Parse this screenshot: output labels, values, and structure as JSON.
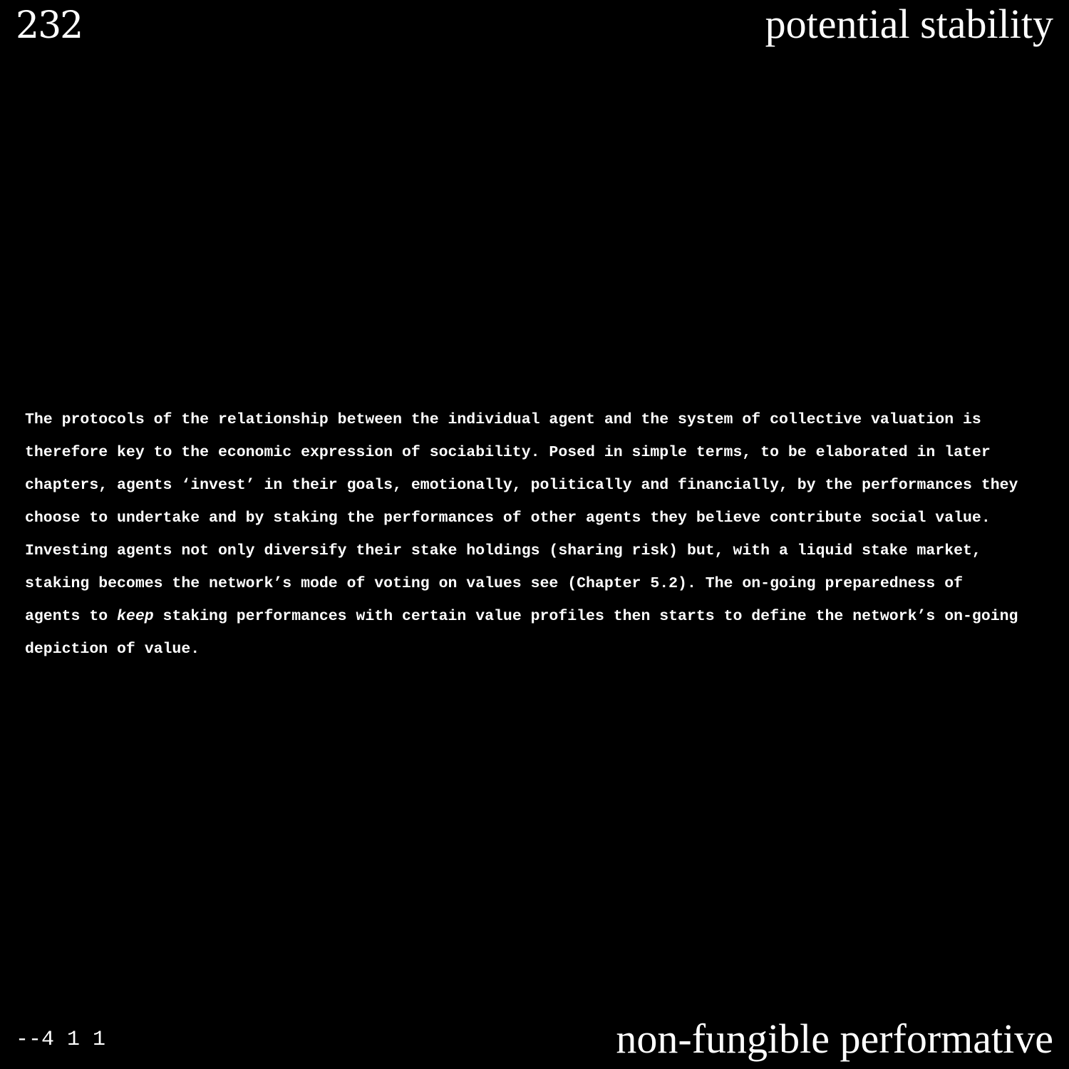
{
  "header": {
    "page_number": "232",
    "running_head": "potential stability"
  },
  "body": {
    "lines": [
      "The protocols of the relationship between the individual agent and the system of collective valuation is",
      "therefore key to the economic expression of sociability. Posed in simple terms, to be elaborated in later",
      "chapters, agents ‘invest’ in their goals, emotionally, politically and financially, by the performances they",
      "choose to undertake and by staking the performances of other agents they believe contribute social value.",
      "Investing agents not only diversify their stake holdings (sharing risk) but, with a liquid stake market,",
      "staking becomes the network’s mode of voting on values see (Chapter 5.2). The on-going preparedness of"
    ],
    "line7_before": "agents to ",
    "line7_emphasis": "keep",
    "line7_after": " staking performances with certain value profiles then starts to define the network’s on-going",
    "line8": "depiction of value."
  },
  "footer": {
    "code": "--4 1 1",
    "title": "non-fungible performative"
  }
}
